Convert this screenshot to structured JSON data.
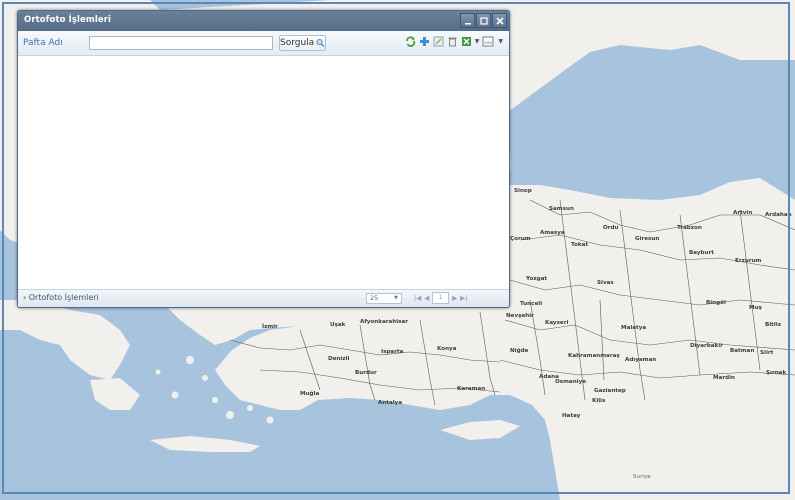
{
  "window": {
    "title": "Ortofoto İşlemleri",
    "controls": [
      "minimize-icon",
      "maximize-icon",
      "close-icon"
    ]
  },
  "toolbar": {
    "label": "Pafta Adı",
    "input_value": "",
    "search_button": "Sorgula",
    "tools": [
      "refresh-icon",
      "add-icon",
      "edit-icon",
      "delete-icon",
      "excel-export-icon",
      "csv-export-icon"
    ],
    "csv_label": "csv"
  },
  "grid": {
    "rows": []
  },
  "paging": {
    "panel_title": "Ortofoto İşlemleri",
    "page_size": "25",
    "page_number": "1"
  },
  "map": {
    "labels": [
      "Sinop",
      "Samsun",
      "Amasya",
      "Ordu",
      "Giresun",
      "Trabzon",
      "Artvin",
      "Ardahan",
      "Çorum",
      "Tokat",
      "Bayburt",
      "Erzurum",
      "Yozgat",
      "Sivas",
      "Bingöl",
      "Muş",
      "Tunceli",
      "Nevşehir",
      "Kayseri",
      "Malatya",
      "Diyarbakır",
      "Bitlis",
      "İzmir",
      "Uşak",
      "Afyonkarahisar",
      "Konya",
      "Niğde",
      "Kahramanmaraş",
      "Adıyaman",
      "Batman",
      "Siirt",
      "Denizli",
      "Isparta",
      "Burdur",
      "Adana",
      "Osmaniye",
      "Gaziantep",
      "Mardin",
      "Şırnak",
      "Muğla",
      "Antalya",
      "Karaman",
      "Kilis",
      "Hatay",
      "Suriye"
    ],
    "colors": {
      "sea": "#a8c3dd",
      "land": "#f2f0ed",
      "border": "#5a5a5a"
    }
  }
}
